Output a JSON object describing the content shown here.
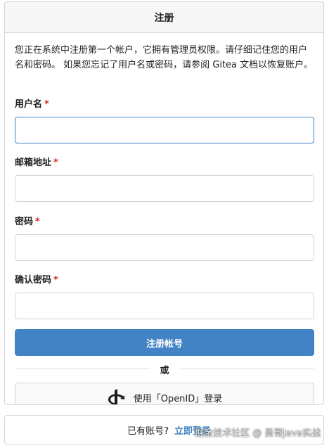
{
  "colors": {
    "primary": "#4183c4",
    "required": "#db2828",
    "border": "#d4d4d5",
    "header_bg": "#f7f7f7"
  },
  "card": {
    "title": "注册",
    "notice": "您正在系统中注册第一个帐户，它拥有管理员权限。请仔细记住您的用户名和密码。 如果您忘记了用户名或密码，请参阅 Gitea 文档以恢复账户。"
  },
  "form": {
    "username_label": "用户名",
    "email_label": "邮箱地址",
    "password_label": "密码",
    "confirm_label": "确认密码",
    "required_mark": "*",
    "submit_label": "注册帐号"
  },
  "divider": {
    "text": "或"
  },
  "openid": {
    "icon": "openid-icon",
    "label": "使用「OpenID」登录"
  },
  "footer": {
    "question": "已有账号?",
    "login_link": "立即登录"
  },
  "watermark": "掘金技术社区 @ 勇哥Java实战"
}
